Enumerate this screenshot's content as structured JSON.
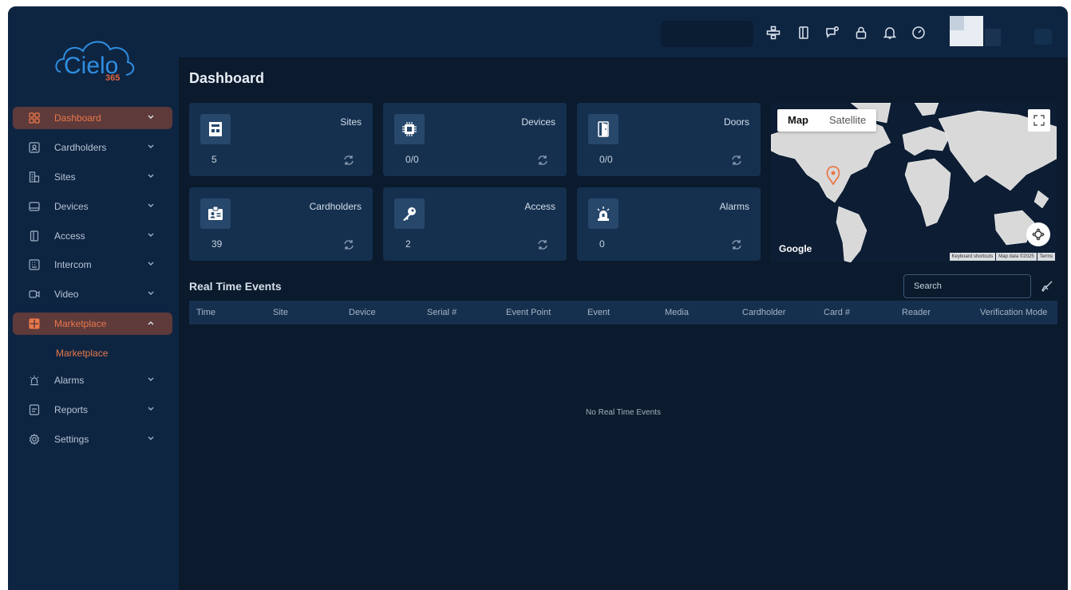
{
  "brand": {
    "name": "Cielo",
    "sub": "365",
    "accent": "#e9784a",
    "logo_color": "#2f8ee0"
  },
  "sidebar": {
    "items": [
      {
        "label": "Dashboard",
        "icon": "grid-icon"
      },
      {
        "label": "Cardholders",
        "icon": "id-card-icon"
      },
      {
        "label": "Sites",
        "icon": "building-icon"
      },
      {
        "label": "Devices",
        "icon": "device-icon"
      },
      {
        "label": "Access",
        "icon": "door-icon"
      },
      {
        "label": "Intercom",
        "icon": "intercom-icon"
      },
      {
        "label": "Video",
        "icon": "video-icon"
      },
      {
        "label": "Marketplace",
        "icon": "marketplace-icon"
      },
      {
        "label": "Alarms",
        "icon": "siren-icon"
      },
      {
        "label": "Reports",
        "icon": "report-icon"
      },
      {
        "label": "Settings",
        "icon": "gear-icon"
      }
    ],
    "sub_item": "Marketplace"
  },
  "page": {
    "title": "Dashboard"
  },
  "cards": [
    {
      "title": "Sites",
      "value": "5",
      "icon": "building-icon"
    },
    {
      "title": "Devices",
      "value": "0/0",
      "icon": "chip-icon"
    },
    {
      "title": "Doors",
      "value": "0/0",
      "icon": "door-icon"
    },
    {
      "title": "Cardholders",
      "value": "39",
      "icon": "id-badge-icon"
    },
    {
      "title": "Access",
      "value": "2",
      "icon": "key-icon"
    },
    {
      "title": "Alarms",
      "value": "0",
      "icon": "siren-icon"
    }
  ],
  "map": {
    "tab_map": "Map",
    "tab_satellite": "Satellite",
    "logo": "Google",
    "attr_shortcuts": "Keyboard shortcuts",
    "attr_data": "Map data ©2025",
    "attr_terms": "Terms"
  },
  "events": {
    "title": "Real Time Events",
    "search_placeholder": "Search",
    "columns": [
      "Time",
      "Site",
      "Device",
      "Serial #",
      "Event Point",
      "Event",
      "Media",
      "Cardholder",
      "Card #",
      "Reader",
      "Verification Mode"
    ],
    "empty_text": "No Real Time Events"
  }
}
